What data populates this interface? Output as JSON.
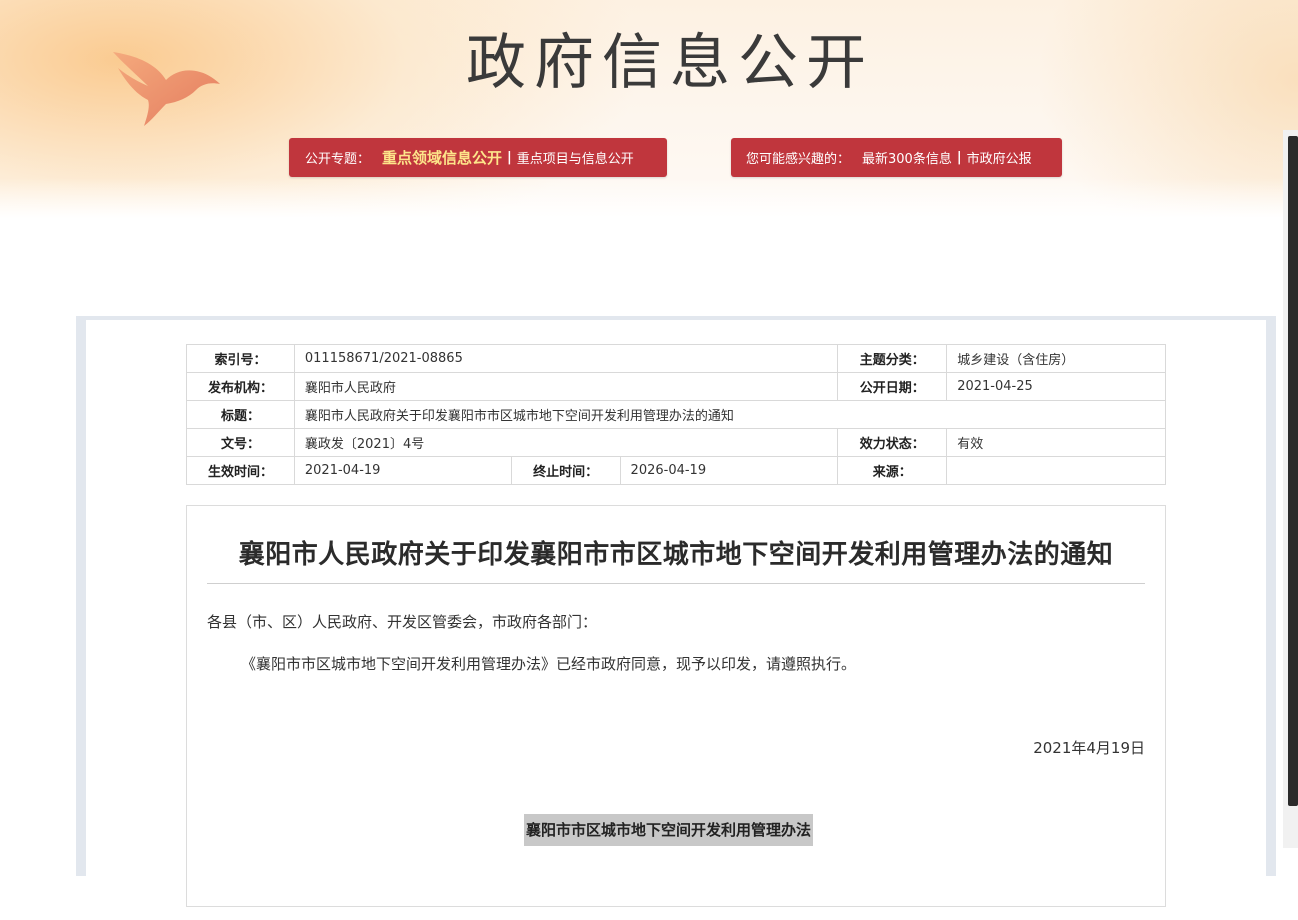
{
  "header": {
    "site_title": "政府信息公开",
    "topics": {
      "label": "公开专题：",
      "highlight": "重点领域信息公开",
      "separator": "|",
      "link": "重点项目与信息公开"
    },
    "interests": {
      "label": "您可能感兴趣的：",
      "link1": "最新300条信息",
      "separator": "|",
      "link2": "市政府公报"
    }
  },
  "meta": {
    "index_label": "索引号：",
    "index_value": "011158671/2021-08865",
    "topic_label": "主题分类：",
    "topic_value": "城乡建设（含住房）",
    "org_label": "发布机构：",
    "org_value": "襄阳市人民政府",
    "pubdate_label": "公开日期：",
    "pubdate_value": "2021-04-25",
    "title_label": "标题：",
    "title_value": "襄阳市人民政府关于印发襄阳市市区城市地下空间开发利用管理办法的通知",
    "docno_label": "文号：",
    "docno_value": "襄政发〔2021〕4号",
    "status_label": "效力状态：",
    "status_value": "有效",
    "effective_label": "生效时间：",
    "effective_value": "2021-04-19",
    "end_label": "终止时间：",
    "end_value": "2026-04-19",
    "source_label": "来源：",
    "source_value": ""
  },
  "article": {
    "title": "襄阳市人民政府关于印发襄阳市市区城市地下空间开发利用管理办法的通知",
    "salutation": "各县（市、区）人民政府、开发区管委会，市政府各部门：",
    "body": "《襄阳市市区城市地下空间开发利用管理办法》已经市政府同意，现予以印发，请遵照执行。",
    "date": "2021年4月19日",
    "subtitle": "襄阳市市区城市地下空间开发利用管理办法"
  },
  "colors": {
    "accent_red": "#c0363d",
    "highlight_yellow": "#fde58a",
    "status_green": "#2aa64d"
  }
}
